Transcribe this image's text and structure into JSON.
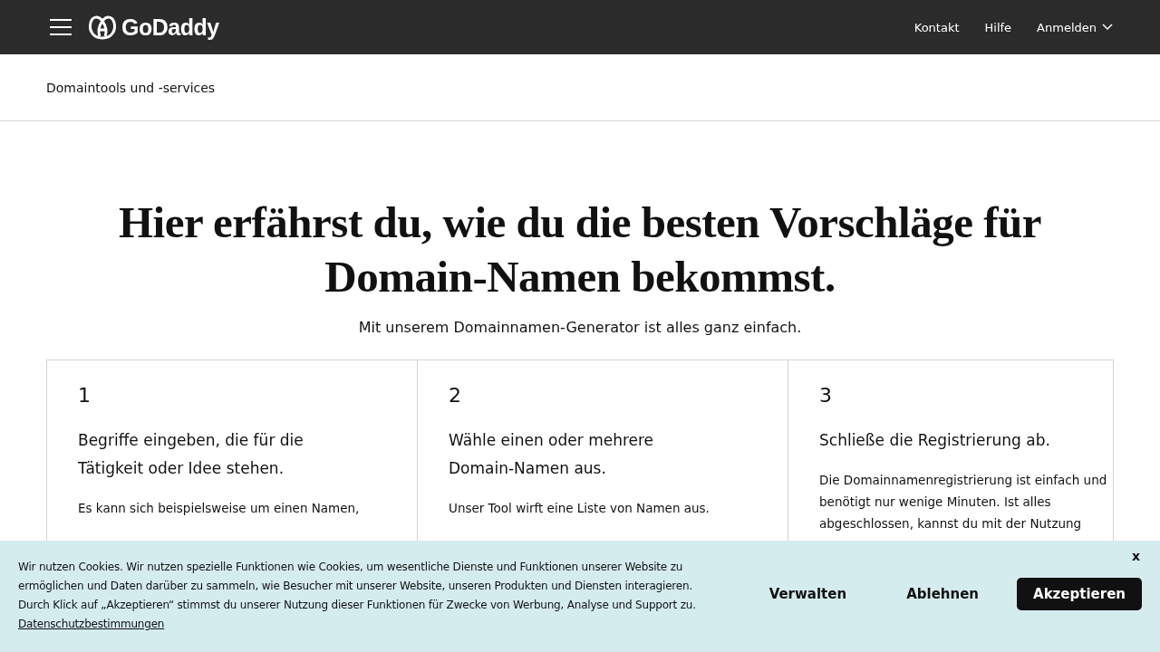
{
  "header": {
    "brand": "GoDaddy",
    "nav": [
      {
        "label": "Kontakt",
        "dropdown": false
      },
      {
        "label": "Hilfe",
        "dropdown": false
      },
      {
        "label": "Anmelden",
        "dropdown": true
      }
    ]
  },
  "subnav": {
    "title": "Domaintools und -services"
  },
  "hero": {
    "title": "Hier erfährst du, wie du die besten Vorschläge für Domain-Namen bekommst.",
    "subtitle": "Mit unserem Domainnamen-Generator ist alles ganz einfach."
  },
  "steps": [
    {
      "number": "1",
      "title": "Begriffe eingeben, die für die Tätigkeit oder Idee stehen.",
      "text": "Es kann sich beispielsweise um einen Namen,"
    },
    {
      "number": "2",
      "title": "Wähle einen oder mehrere Domain-Namen aus.",
      "text": "Unser Tool wirft eine Liste von Namen aus."
    },
    {
      "number": "3",
      "title": "Schließe die Registrierung ab.",
      "text": "Die Domainnamenregistrierung ist einfach und benötigt nur wenige Minuten. Ist alles abgeschlossen, kannst du mit der Nutzung"
    }
  ],
  "cookie_banner": {
    "text": "Wir nutzen Cookies. Wir nutzen spezielle Funktionen wie Cookies, um wesentliche Dienste und Funktionen unserer Website zu ermöglichen und Daten darüber zu sammeln, wie Besucher mit unserer Website, unseren Produkten und Diensten interagieren. Durch Klick auf „Akzeptieren“ stimmst du unserer Nutzung dieser Funktionen für Zwecke von Werbung, Analyse und Support zu.",
    "link": "Datenschutzbestimmungen",
    "close": "x",
    "buttons": [
      {
        "label": "Verwalten",
        "kind": "plain"
      },
      {
        "label": "Ablehnen",
        "kind": "plain"
      },
      {
        "label": "Akzeptieren",
        "kind": "primary"
      }
    ]
  }
}
